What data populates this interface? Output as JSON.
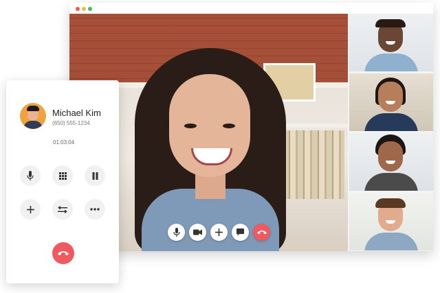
{
  "window": {
    "controls": [
      "close",
      "minimize",
      "maximize"
    ]
  },
  "call_card": {
    "contact_name": "Michael Kim",
    "phone_number": "(650) 555-1234",
    "duration": "01:03:04",
    "buttons": [
      {
        "name": "mute",
        "icon": "microphone-icon"
      },
      {
        "name": "keypad",
        "icon": "dialpad-icon"
      },
      {
        "name": "hold",
        "icon": "pause-icon"
      },
      {
        "name": "add-call",
        "icon": "plus-icon"
      },
      {
        "name": "transfer",
        "icon": "transfer-arrows-icon"
      },
      {
        "name": "more",
        "icon": "more-dots-icon"
      }
    ],
    "end_call_icon": "phone-hangup-icon"
  },
  "video": {
    "controls": [
      {
        "name": "microphone",
        "icon": "microphone-icon"
      },
      {
        "name": "camera",
        "icon": "video-camera-icon"
      },
      {
        "name": "add-participant",
        "icon": "plus-icon"
      },
      {
        "name": "chat",
        "icon": "chat-icon"
      },
      {
        "name": "end-call",
        "icon": "phone-hangup-icon"
      }
    ],
    "participant_count_thumbnails": 4
  },
  "colors": {
    "end_call": "#ee5a5f",
    "avatar_bg": "#f0a23c"
  }
}
